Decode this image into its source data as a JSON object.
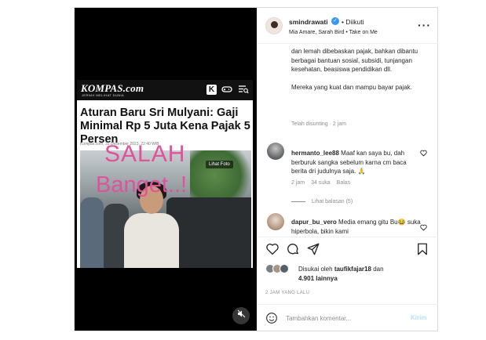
{
  "media": {
    "brand": "KOMPAS.com",
    "brand_tag": "JERNIH MELIHAT DUNIA",
    "headline": "Aturan Baru Sri Mulyani: Gaji Minimal Rp 5 Juta Kena Pajak 5 Persen",
    "byline": "Kompas.com, 31 Desember 2023, 22:40 WIB",
    "photo_button": "Lihat Foto",
    "overlay_line1": "SALAH",
    "overlay_line2": "Banget..!",
    "overlay_color": "#e0529c",
    "icons": [
      "k-icon",
      "gamepad-icon",
      "menu-search-icon",
      "mute-icon"
    ]
  },
  "header": {
    "username": "smindrawati",
    "separator": "•",
    "follow_status": "Diikuti",
    "music": "Mia Amare, Sarah Bird • Take on Me"
  },
  "caption": {
    "paragraph1": "dan lemah dibebaskan pajak, bahkan dibantu berbagai bantuan sosial, subsidi, tunjangan kesehatan, beasiswa pendidikan dll.",
    "paragraph2": "Mereka yang kuat dan mampu bayar pajak.",
    "meta": "Telah disunting · 2 jam"
  },
  "comments": [
    {
      "username": "hermanto_lee88",
      "text": "Maaf kan saya bu, dah berburuk sangka sebelum karna cm baca berita dri judulnya saja. 🙏",
      "time": "2 jam",
      "likes": "34 suka",
      "reply": "Balas",
      "view_replies": "Lihat balasan (5)"
    },
    {
      "username": "dapur_bu_vero",
      "text": "Media emang gitu Bu😂 suka hiperbola, bikin kami"
    }
  ],
  "likes": {
    "prefix": "Disukai oleh",
    "user": "taufikfajar18",
    "and": "dan",
    "count": "4.901 lainnya"
  },
  "timestamp": "2 JAM YANG LALU",
  "add_comment": {
    "placeholder": "Tambahkan komentar...",
    "send": "Kirim"
  }
}
